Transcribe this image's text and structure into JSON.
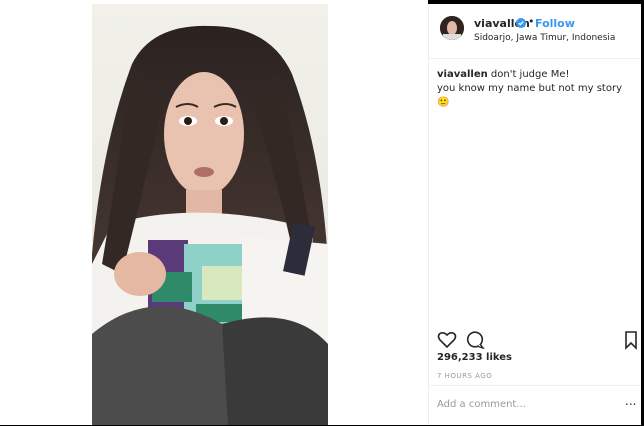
{
  "post": {
    "username": "viavallen",
    "follow_label": "Follow",
    "location": "Sidoarjo, Jawa Timur, Indonesia",
    "caption_user": "viavallen",
    "caption_line1": "don't judge Me!",
    "caption_line2": "you know my name but not my story 🙂",
    "likes": "296,233 likes",
    "time": "7 HOURS AGO",
    "comment_placeholder": "Add a comment...",
    "more_label": "..."
  },
  "icons": {
    "verified": "verified-badge-icon",
    "like": "heart-icon",
    "comment": "comment-bubble-icon",
    "save": "bookmark-icon"
  },
  "colors": {
    "link": "#3897f0",
    "text": "#262626",
    "muted": "#999999",
    "divider": "#efefef"
  }
}
